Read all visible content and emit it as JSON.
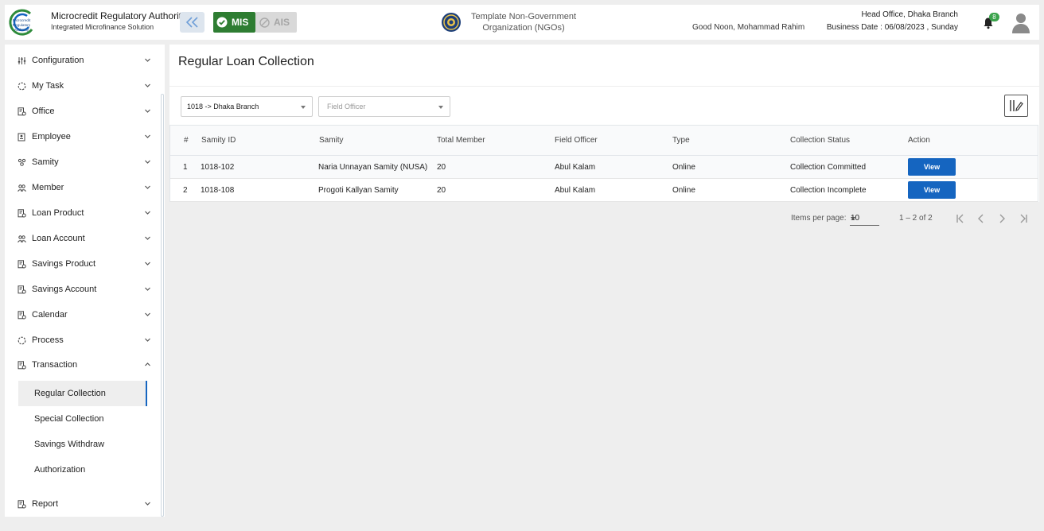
{
  "header": {
    "brand_title": "Microcredit Regulatory Authority",
    "brand_subtitle": "Integrated Microfinance Solution",
    "logo_text": [
      "Microcredit",
      "Regulatory",
      "Authority"
    ],
    "mis_label": "MIS",
    "ais_label": "AIS",
    "org_name": "Template Non-Government Organization (NGOs)",
    "greeting": "Good Noon, Mohammad Rahim",
    "office": "Head Office, Dhaka Branch",
    "business_date": "Business Date : 06/08/2023 , Sunday",
    "notification_count": "8",
    "icons": [
      "logo",
      "double-chevron-left-icon",
      "check-circle-icon",
      "block-icon",
      "emblem-icon",
      "bell-icon",
      "user-avatar-icon"
    ]
  },
  "sidebar": {
    "items": [
      {
        "label": "Configuration",
        "icon": "sliders-icon",
        "expanded": false
      },
      {
        "label": "My Task",
        "icon": "circle-dashed-icon",
        "expanded": false
      },
      {
        "label": "Office",
        "icon": "document-gear-icon",
        "expanded": false
      },
      {
        "label": "Employee",
        "icon": "id-card-icon",
        "expanded": false
      },
      {
        "label": "Samity",
        "icon": "group-icon",
        "expanded": false
      },
      {
        "label": "Member",
        "icon": "people-icon",
        "expanded": false
      },
      {
        "label": "Loan Product",
        "icon": "document-gear-icon",
        "expanded": false
      },
      {
        "label": "Loan Account",
        "icon": "people-icon",
        "expanded": false
      },
      {
        "label": "Savings Product",
        "icon": "document-gear-icon",
        "expanded": false
      },
      {
        "label": "Savings Account",
        "icon": "document-gear-icon",
        "expanded": false
      },
      {
        "label": "Calendar",
        "icon": "document-gear-icon",
        "expanded": false
      },
      {
        "label": "Process",
        "icon": "circle-dashed-icon",
        "expanded": false
      },
      {
        "label": "Transaction",
        "icon": "document-gear-icon",
        "expanded": true
      },
      {
        "label": "Report",
        "icon": "document-gear-icon",
        "expanded": false
      }
    ],
    "transaction_sub_items": [
      {
        "label": "Regular Collection",
        "active": true
      },
      {
        "label": "Special Collection",
        "active": false
      },
      {
        "label": "Savings Withdraw",
        "active": false
      },
      {
        "label": "Authorization",
        "active": false
      }
    ]
  },
  "main": {
    "title": "Regular Loan Collection",
    "filters": {
      "branch_value": "1018 -> Dhaka Branch",
      "field_officer_placeholder": "Field Officer"
    },
    "table": {
      "headers": [
        "#",
        "Samity ID",
        "Samity",
        "Total Member",
        "Field Officer",
        "Type",
        "Collection Status",
        "Action"
      ],
      "rows": [
        [
          "1",
          "1018-102",
          "Naria Unnayan Samity (NUSA)",
          "20",
          "Abul Kalam",
          "Online",
          "Collection Committed",
          "View"
        ],
        [
          "2",
          "1018-108",
          "Progoti Kallyan Samity",
          "20",
          "Abul Kalam",
          "Online",
          "Collection Incomplete",
          "View"
        ]
      ]
    },
    "paginator": {
      "items_per_page_label": "Items per page:",
      "items_per_page_value": "10",
      "range_label": "1 – 2 of 2"
    }
  },
  "colors": {
    "mis_green": "#2e7d32",
    "primary_blue": "#1565c0",
    "badge_green": "#3aa34b"
  }
}
